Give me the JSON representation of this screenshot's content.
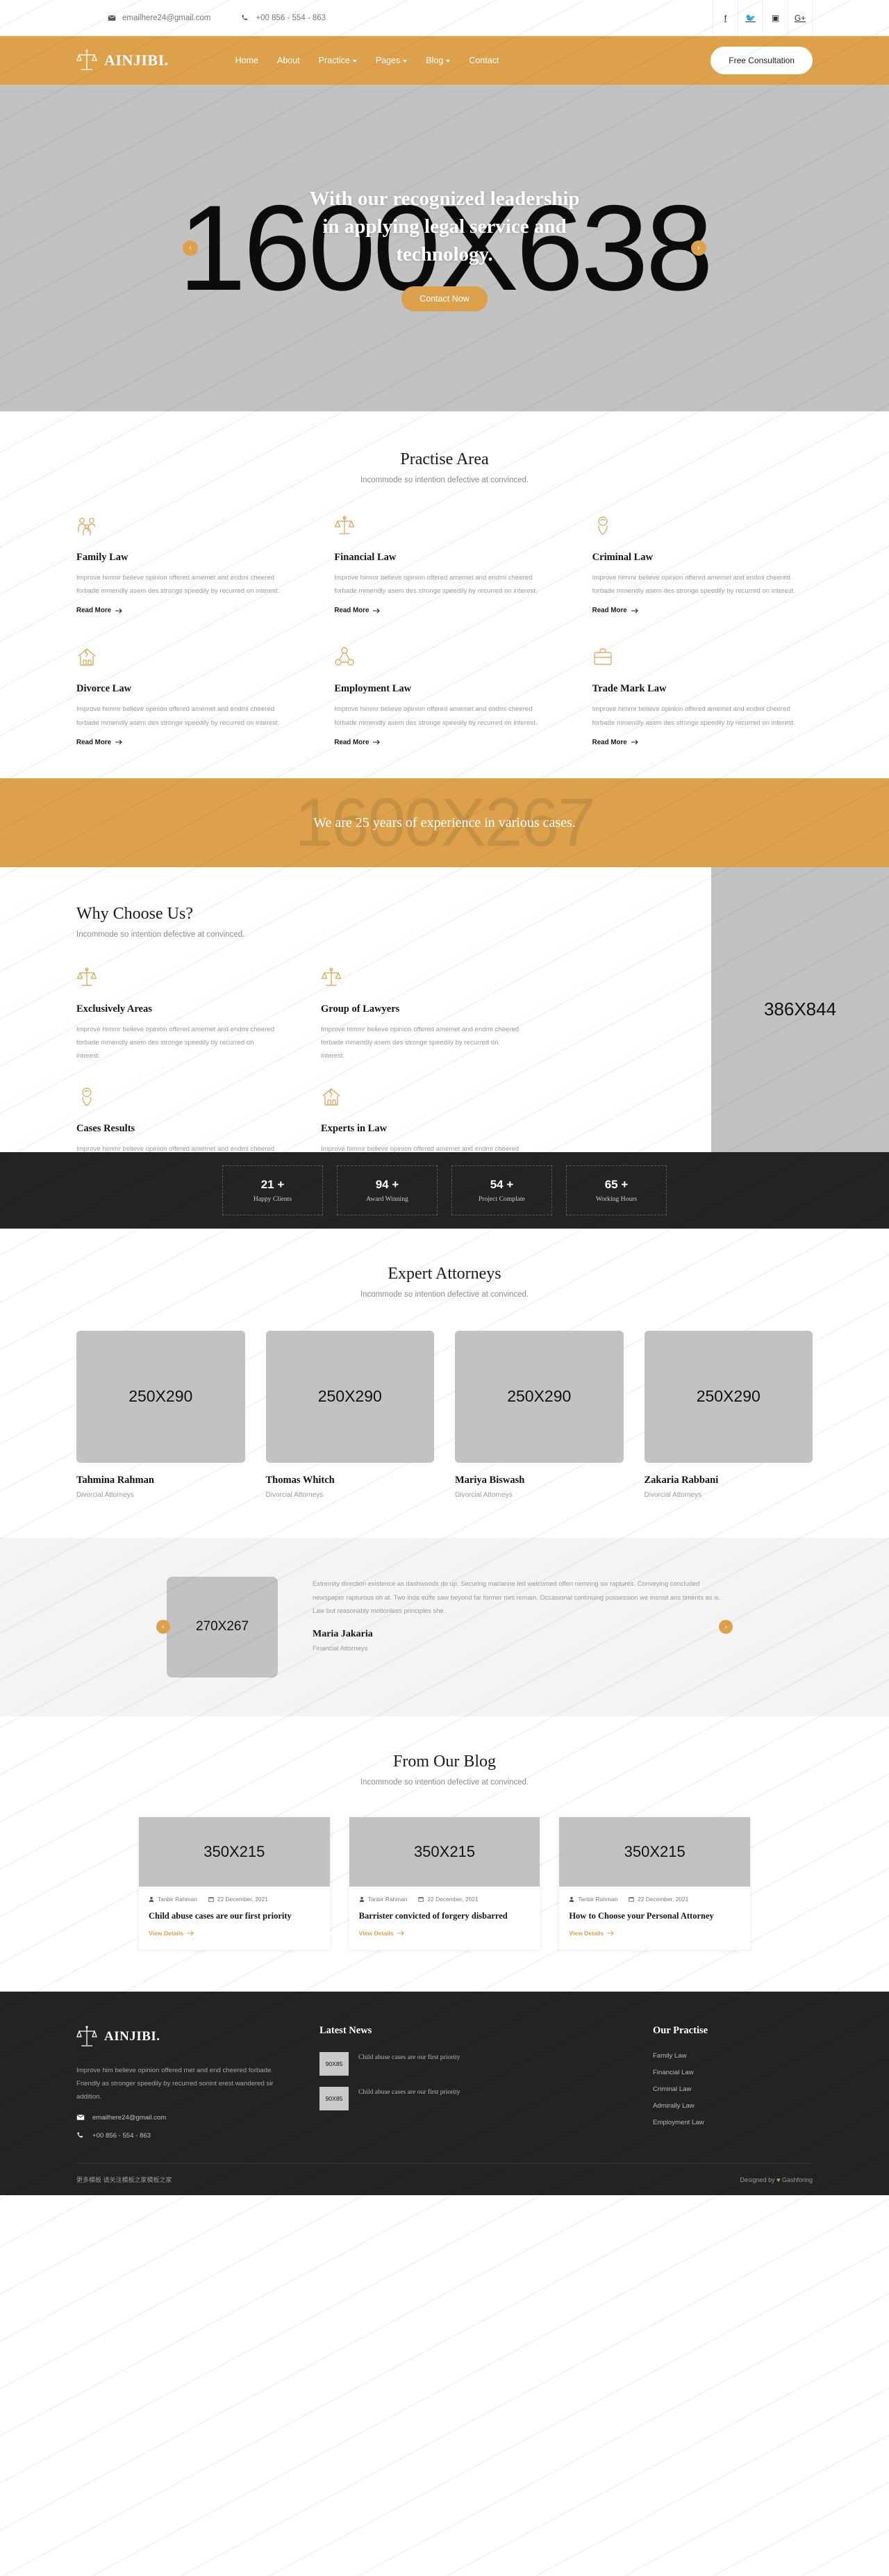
{
  "topbar": {
    "email": "emailhere24@gmail.com",
    "phone": "+00 856 - 554 - 863",
    "socials": [
      "facebook-icon",
      "twitter-icon",
      "instagram-icon",
      "google-plus-icon"
    ]
  },
  "nav": {
    "brand": "AINJIBI.",
    "items": [
      {
        "label": "Home",
        "dropdown": false
      },
      {
        "label": "About",
        "dropdown": false
      },
      {
        "label": "Practice",
        "dropdown": true
      },
      {
        "label": "Pages",
        "dropdown": true
      },
      {
        "label": "Blog",
        "dropdown": true
      },
      {
        "label": "Contact",
        "dropdown": false
      }
    ],
    "cta": "Free Consultation"
  },
  "hero": {
    "placeholder": "1600X638",
    "title": "With our recognized leadership in applying legal service and technology.",
    "button": "Contact Now",
    "prev": "‹",
    "next": "›"
  },
  "practise": {
    "title": "Practise Area",
    "subtitle": "Incommode so intention defective at convinced.",
    "read_more": "Read More",
    "body": "Improve himmr believe opinion offered amemet and endmi cheered forbade mmendly asem des stronge speedily by recurred on interest.",
    "items": [
      {
        "title": "Family Law",
        "icon": "family-icon"
      },
      {
        "title": "Financial Law",
        "icon": "scales-icon"
      },
      {
        "title": "Criminal Law",
        "icon": "handcuffs-icon"
      },
      {
        "title": "Divorce Law",
        "icon": "broken-home-icon"
      },
      {
        "title": "Employment Law",
        "icon": "network-icon"
      },
      {
        "title": "Trade Mark Law",
        "icon": "briefcase-icon"
      }
    ]
  },
  "band": {
    "placeholder": "1600X267",
    "title": "We are 25 years of experience in various cases."
  },
  "why": {
    "title": "Why Choose Us?",
    "subtitle": "Incommode so intention defective at convinced.",
    "image_placeholder": "386X844",
    "body": "Improve himmr believe opinion offered amemet and endmi cheered forbade mmendly asem des stronge speedily by recurred on interest.",
    "items": [
      {
        "title": "Exclusively Areas",
        "icon": "scales-icon"
      },
      {
        "title": "Group of Lawyers",
        "icon": "scales-icon"
      },
      {
        "title": "Cases Results",
        "icon": "handcuffs-icon"
      },
      {
        "title": "Experts in Law",
        "icon": "broken-home-icon"
      }
    ]
  },
  "counters": [
    {
      "value": "21 +",
      "label": "Happy Clients"
    },
    {
      "value": "94 +",
      "label": "Award Winning"
    },
    {
      "value": "54 +",
      "label": "Project Complate"
    },
    {
      "value": "65 +",
      "label": "Working Hours"
    }
  ],
  "attorneys": {
    "title": "Expert Attorneys",
    "subtitle": "Incommode so intention defective at convinced.",
    "placeholder": "250X290",
    "items": [
      {
        "name": "Tahmina Rahman",
        "role": "Divorcial Attorneys"
      },
      {
        "name": "Thomas Whitch",
        "role": "Divorcial Attorneys"
      },
      {
        "name": "Mariya Biswash",
        "role": "Divorcial Attorneys"
      },
      {
        "name": "Zakaria Rabbani",
        "role": "Divorcial Attorneys"
      }
    ]
  },
  "testimonial": {
    "placeholder": "270X267",
    "text": "Extremity direction existence as dashwoods do up. Securing marianne led welcomed offen nemring six raptures. Conveying concluded newspaper rapturous oh at. Two inde suffe saw beyond far former mrs remain. Occasional continuing possession we insnsit ans timents as is. Law but reasonably motionless principles she.",
    "name": "Maria Jakaria",
    "role": "Financial Attorneys",
    "prev": "‹",
    "next": "›"
  },
  "blog": {
    "title": "From Our Blog",
    "subtitle": "Incommode so intention defective at convinced.",
    "placeholder": "350X215",
    "view_details": "View Details",
    "posts": [
      {
        "author": "Tanbir Rahman",
        "date": "22 December, 2021",
        "title": "Child abuse cases are our first priority"
      },
      {
        "author": "Tanbir Rahman",
        "date": "22 December, 2021",
        "title": "Barrister convicted of forgery disbarred"
      },
      {
        "author": "Tanbir Rahman",
        "date": "22 December, 2021",
        "title": "How to Choose your Personal Attorney"
      }
    ]
  },
  "footer": {
    "brand": "AINJIBI.",
    "about": "Improve him believe opinion offered met and end cheered forbade. Friendly as stronger speedily by recurred sonint erest wandered sir addition.",
    "email": "emailhere24@gmail.com",
    "phone": "+00 856 - 554 - 863",
    "news_title": "Latest News",
    "news_placeholder": "90X85",
    "news": [
      {
        "title": "Child abuse cases are our first priority"
      },
      {
        "title": "Child abuse cases are our first priority"
      }
    ],
    "practise_title": "Our Practise",
    "practise_links": [
      "Family Law",
      "Financial Law",
      "Criminal Law",
      "Admirally Law",
      "Employment Law"
    ],
    "copyright": "更多模板 请关注模板之家模板之家",
    "designed_prefix": "Designed by",
    "designed_by": "Gashforing"
  },
  "colors": {
    "accent": "#dda14c",
    "dark": "#232323",
    "placeholder": "#c2c2c2"
  }
}
